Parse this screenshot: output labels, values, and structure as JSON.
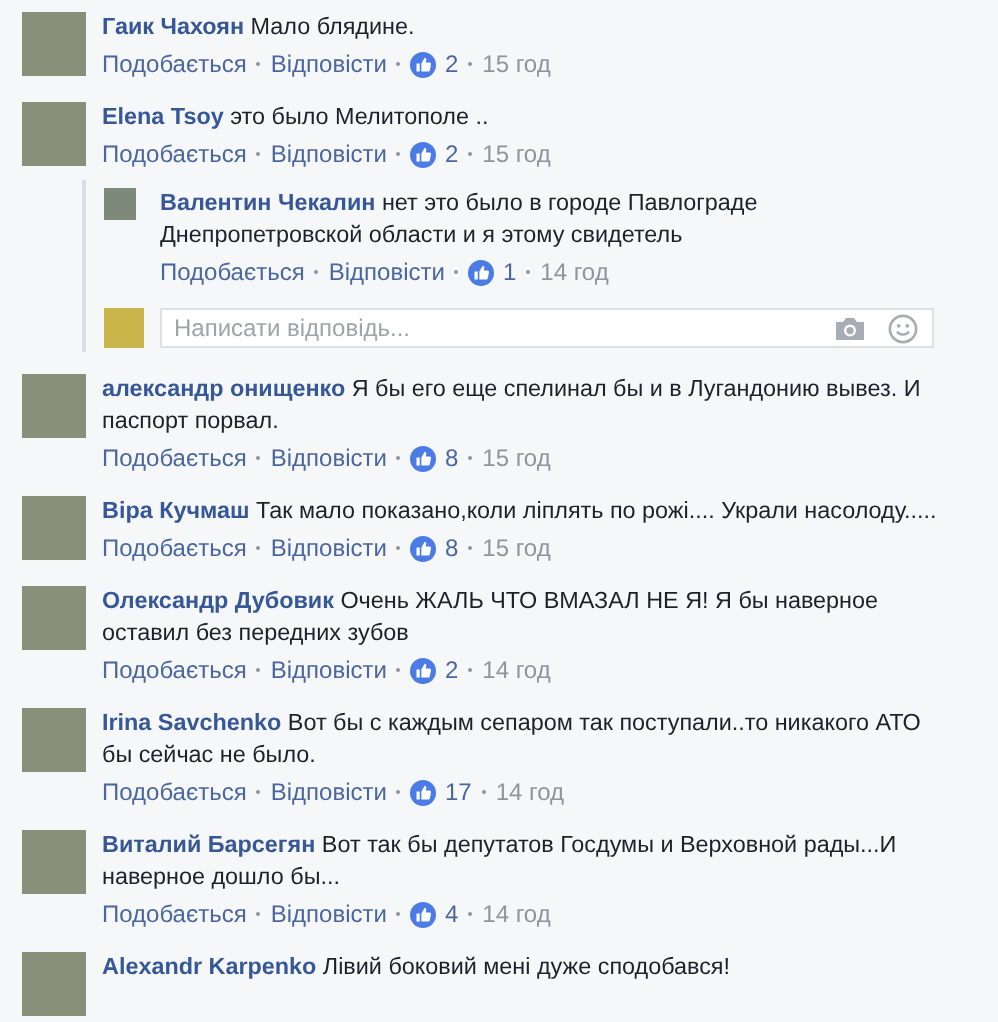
{
  "comments": [
    {
      "author": "Гаик Чахоян",
      "text": "Мало блядине.",
      "actions": {
        "like": "Подобається",
        "reply": "Відповісти",
        "likes": "2",
        "time": "15 год"
      }
    },
    {
      "author": "Elena Tsoy",
      "text": "это было Мелитополе ..",
      "actions": {
        "like": "Подобається",
        "reply": "Відповісти",
        "likes": "2",
        "time": "15 год"
      },
      "replies": [
        {
          "author": "Валентин Чекалин",
          "text": "нет это было в городе Павлограде Днепропетровской области и я этому свидетель",
          "actions": {
            "like": "Подобається",
            "reply": "Відповісти",
            "likes": "1",
            "time": "14 год"
          }
        }
      ],
      "reply_box": {
        "placeholder": "Написати відповідь..."
      }
    },
    {
      "author": "александр онищенко",
      "text": "Я бы его еще спелинал бы и в Лугандонию вывез. И паспорт порвал.",
      "actions": {
        "like": "Подобається",
        "reply": "Відповісти",
        "likes": "8",
        "time": "15 год"
      }
    },
    {
      "author": "Віра Кучмаш",
      "text": "Так мало показано,коли ліплять по рожі.... Украли насолоду.....",
      "actions": {
        "like": "Подобається",
        "reply": "Відповісти",
        "likes": "8",
        "time": "15 год"
      }
    },
    {
      "author": "Олександр Дубовик",
      "text": "Очень ЖАЛЬ ЧТО ВМАЗАЛ НЕ Я! Я бы наверное оставил без передних зубов",
      "actions": {
        "like": "Подобається",
        "reply": "Відповісти",
        "likes": "2",
        "time": "14 год"
      }
    },
    {
      "author": "Irina Savchenko",
      "text": "Вот бы с каждым сепаром так поступали..то никакого АТО бы сейчас не было.",
      "actions": {
        "like": "Подобається",
        "reply": "Відповісти",
        "likes": "17",
        "time": "14 год"
      }
    },
    {
      "author": "Виталий Барсегян",
      "text": "Вот так бы депутатов Госдумы и Верховной рады...И наверное дошло бы...",
      "actions": {
        "like": "Подобається",
        "reply": "Відповісти",
        "likes": "4",
        "time": "14 год"
      }
    },
    {
      "author": "Alexandr Karpenko",
      "text": "Лівий боковий мені дуже сподобався!"
    }
  ]
}
